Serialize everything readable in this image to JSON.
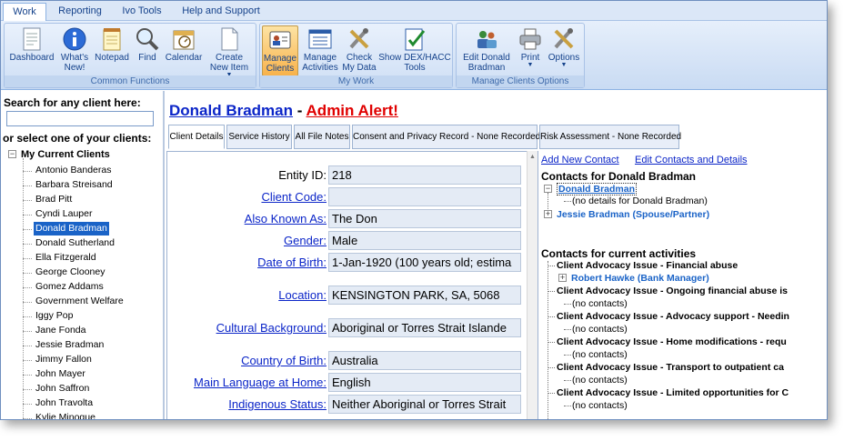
{
  "ribbon_tabs": [
    "Work",
    "Reporting",
    "Ivo Tools",
    "Help and Support"
  ],
  "ribbon_groups": {
    "common": {
      "label": "Common Functions",
      "buttons": [
        "Dashboard",
        "What's\nNew!",
        "Notepad",
        "Find",
        "Calendar",
        "Create\nNew Item"
      ]
    },
    "mywork": {
      "label": "My Work",
      "buttons": [
        "Manage\nClients",
        "Manage\nActivities",
        "Check\nMy Data",
        "Show DEX/HACC\nTools"
      ]
    },
    "options": {
      "label": "Manage Clients Options",
      "buttons": [
        "Edit Donald\nBradman",
        "Print",
        "Options"
      ]
    }
  },
  "left_panel": {
    "search_label": "Search for any client here:",
    "search_value": "",
    "select_label": "or select one of your clients:",
    "tree_root": "My Current Clients",
    "clients": [
      "Antonio Banderas",
      "Barbara Streisand",
      "Brad Pitt",
      "Cyndi Lauper",
      "Donald Bradman",
      "Donald Sutherland",
      "Ella Fitzgerald",
      "George Clooney",
      "Gomez Addams",
      "Government Welfare",
      "Iggy Pop",
      "Jane Fonda",
      "Jessie Bradman",
      "Jimmy Fallon",
      "John Mayer",
      "John Saffron",
      "John Travolta",
      "Kylie Minogue"
    ],
    "selected_client": "Donald Bradman"
  },
  "header": {
    "client_name": "Donald Bradman",
    "separator": "-",
    "alert": "Admin Alert!"
  },
  "detail_tabs": [
    "Client Details",
    "Service History",
    "All File Notes",
    "Consent and Privacy Record - None Recorded",
    "Risk Assessment - None Recorded"
  ],
  "fields": [
    {
      "label": "Entity ID:",
      "value": "218"
    },
    {
      "label": "Client Code:",
      "value": ""
    },
    {
      "label": "Also Known As:",
      "value": "The Don"
    },
    {
      "label": "Gender:",
      "value": "Male"
    },
    {
      "label": "Date of Birth:",
      "value": "1-Jan-1920 (100 years old; estima"
    },
    {
      "label": "Location:",
      "value": "KENSINGTON PARK, SA, 5068"
    },
    {
      "label": "Cultural Background:",
      "value": "Aboriginal or Torres Strait Islande"
    },
    {
      "label": "Country of Birth:",
      "value": "Australia"
    },
    {
      "label": "Main Language at Home:",
      "value": "English"
    },
    {
      "label": "Indigenous Status:",
      "value": "Neither Aboriginal or Torres Strait"
    }
  ],
  "contacts_panel": {
    "add_link": "Add New Contact",
    "edit_link": "Edit Contacts and Details",
    "contacts_title": "Contacts for Donald Bradman",
    "primary_contact": "Donald Bradman",
    "primary_note": "(no details for Donald Bradman)",
    "secondary_contact": "Jessie Bradman (Spouse/Partner)",
    "activities_title": "Contacts for current activities",
    "activities": [
      {
        "title": "Client Advocacy Issue - Financial abuse",
        "child": "Robert Hawke (Bank Manager)"
      },
      {
        "title": "Client Advocacy Issue - Ongoing financial abuse is",
        "child": "(no contacts)"
      },
      {
        "title": "Client Advocacy Issue - Advocacy support - Needin",
        "child": "(no contacts)"
      },
      {
        "title": "Client Advocacy Issue - Home modifications - requ",
        "child": "(no contacts)"
      },
      {
        "title": "Client Advocacy Issue - Transport to outpatient ca",
        "child": "(no contacts)"
      },
      {
        "title": "Client Advocacy Issue - Limited opportunities for C",
        "child": "(no contacts)"
      }
    ]
  }
}
